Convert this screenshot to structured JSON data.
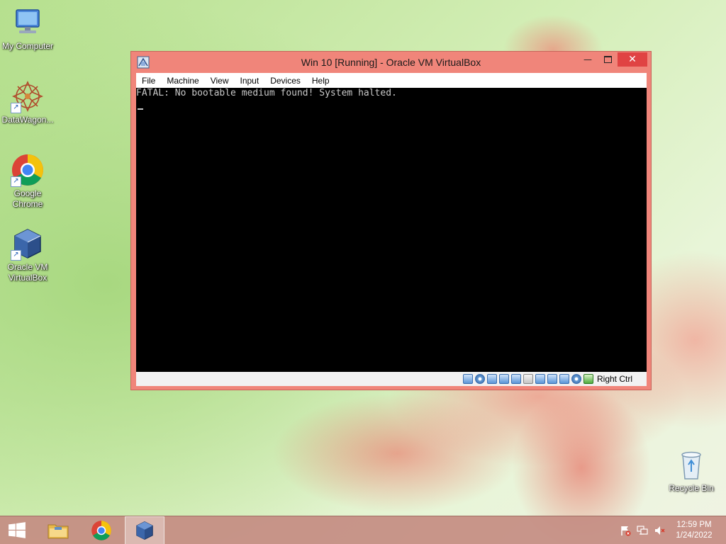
{
  "desktop": {
    "icons": [
      {
        "label": "My Computer",
        "icon": "computer-icon"
      },
      {
        "label": "DataWagon...",
        "icon": "datawagon-icon"
      },
      {
        "label": "Google\nChrome",
        "icon": "chrome-icon"
      },
      {
        "label": "Oracle VM\nVirtualBox",
        "icon": "virtualbox-icon"
      },
      {
        "label": "Recycle Bin",
        "icon": "recycle-bin-icon"
      }
    ]
  },
  "window": {
    "title": "Win 10 [Running] - Oracle VM VirtualBox",
    "menu": [
      "File",
      "Machine",
      "View",
      "Input",
      "Devices",
      "Help"
    ],
    "console_text": "FATAL: No bootable medium found! System halted.",
    "host_key": "Right Ctrl",
    "status_icons": [
      "hard-disk-icon",
      "optical-drive-icon",
      "audio-icon",
      "network-icon",
      "usb-icon",
      "shared-folders-icon",
      "display-icon",
      "video-capture-icon",
      "cpu-icon",
      "mouse-integration-icon",
      "host-key-arrow-icon"
    ]
  },
  "taskbar": {
    "clock_time": "12:59 PM",
    "clock_date": "1/24/2022",
    "tray_icons": [
      "action-center-flag-icon",
      "network-icon",
      "volume-muted-icon"
    ]
  },
  "colors": {
    "window_frame": "#f0857a",
    "close_button": "#e04343",
    "taskbar": "#c48c82"
  }
}
